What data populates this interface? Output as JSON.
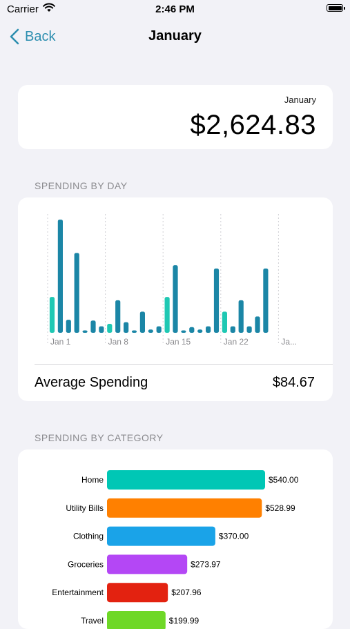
{
  "status": {
    "carrier": "Carrier",
    "time": "2:46 PM"
  },
  "nav": {
    "back_label": "Back",
    "title": "January"
  },
  "total": {
    "month": "January",
    "amount": "$2,624.83"
  },
  "sections": {
    "by_day": "SPENDING BY DAY",
    "by_category": "SPENDING BY CATEGORY"
  },
  "average": {
    "label": "Average Spending",
    "value": "$84.67"
  },
  "colors": {
    "accent": "#2e8fb0",
    "bar_dark": "#1b86a6",
    "bar_teal": "#1fc8b3",
    "background": "#f2f2f7"
  },
  "chart_data": [
    {
      "type": "bar",
      "title": "",
      "x_tick_labels": [
        "Jan 1",
        "Jan 8",
        "Jan 15",
        "Jan 22",
        "Ja..."
      ],
      "x": [
        1,
        2,
        3,
        4,
        5,
        6,
        7,
        8,
        9,
        10,
        11,
        12,
        13,
        14,
        15,
        16,
        17,
        18,
        19,
        20,
        21,
        22,
        23,
        24,
        25,
        26,
        27,
        28,
        29,
        30,
        31
      ],
      "values": [
        44,
        139,
        16,
        98,
        3,
        15,
        8,
        11,
        40,
        13,
        3,
        26,
        4,
        8,
        44,
        83,
        3,
        7,
        4,
        8,
        79,
        26,
        8,
        40,
        8,
        20,
        79,
        0,
        0,
        0,
        0
      ],
      "bar_colors_by_weekday": "teal on Jan 1, 8, 15, 22, 29; dark teal otherwise",
      "ylim": [
        0,
        145
      ],
      "grid": "vertical dashed lines at week starts"
    },
    {
      "type": "bar",
      "orientation": "horizontal",
      "title": "",
      "categories": [
        "Home",
        "Utility Bills",
        "Clothing",
        "Groceries",
        "Entertainment",
        "Travel"
      ],
      "values": [
        540.0,
        528.99,
        370.0,
        273.97,
        207.96,
        199.99
      ],
      "value_labels": [
        "$540.00",
        "$528.99",
        "$370.00",
        "$273.97",
        "$207.96",
        "$199.99"
      ],
      "colors": [
        "#00c7b5",
        "#ff8000",
        "#1aa3e8",
        "#b447f5",
        "#e32210",
        "#6ed827"
      ],
      "xlim": [
        0,
        540
      ]
    }
  ]
}
